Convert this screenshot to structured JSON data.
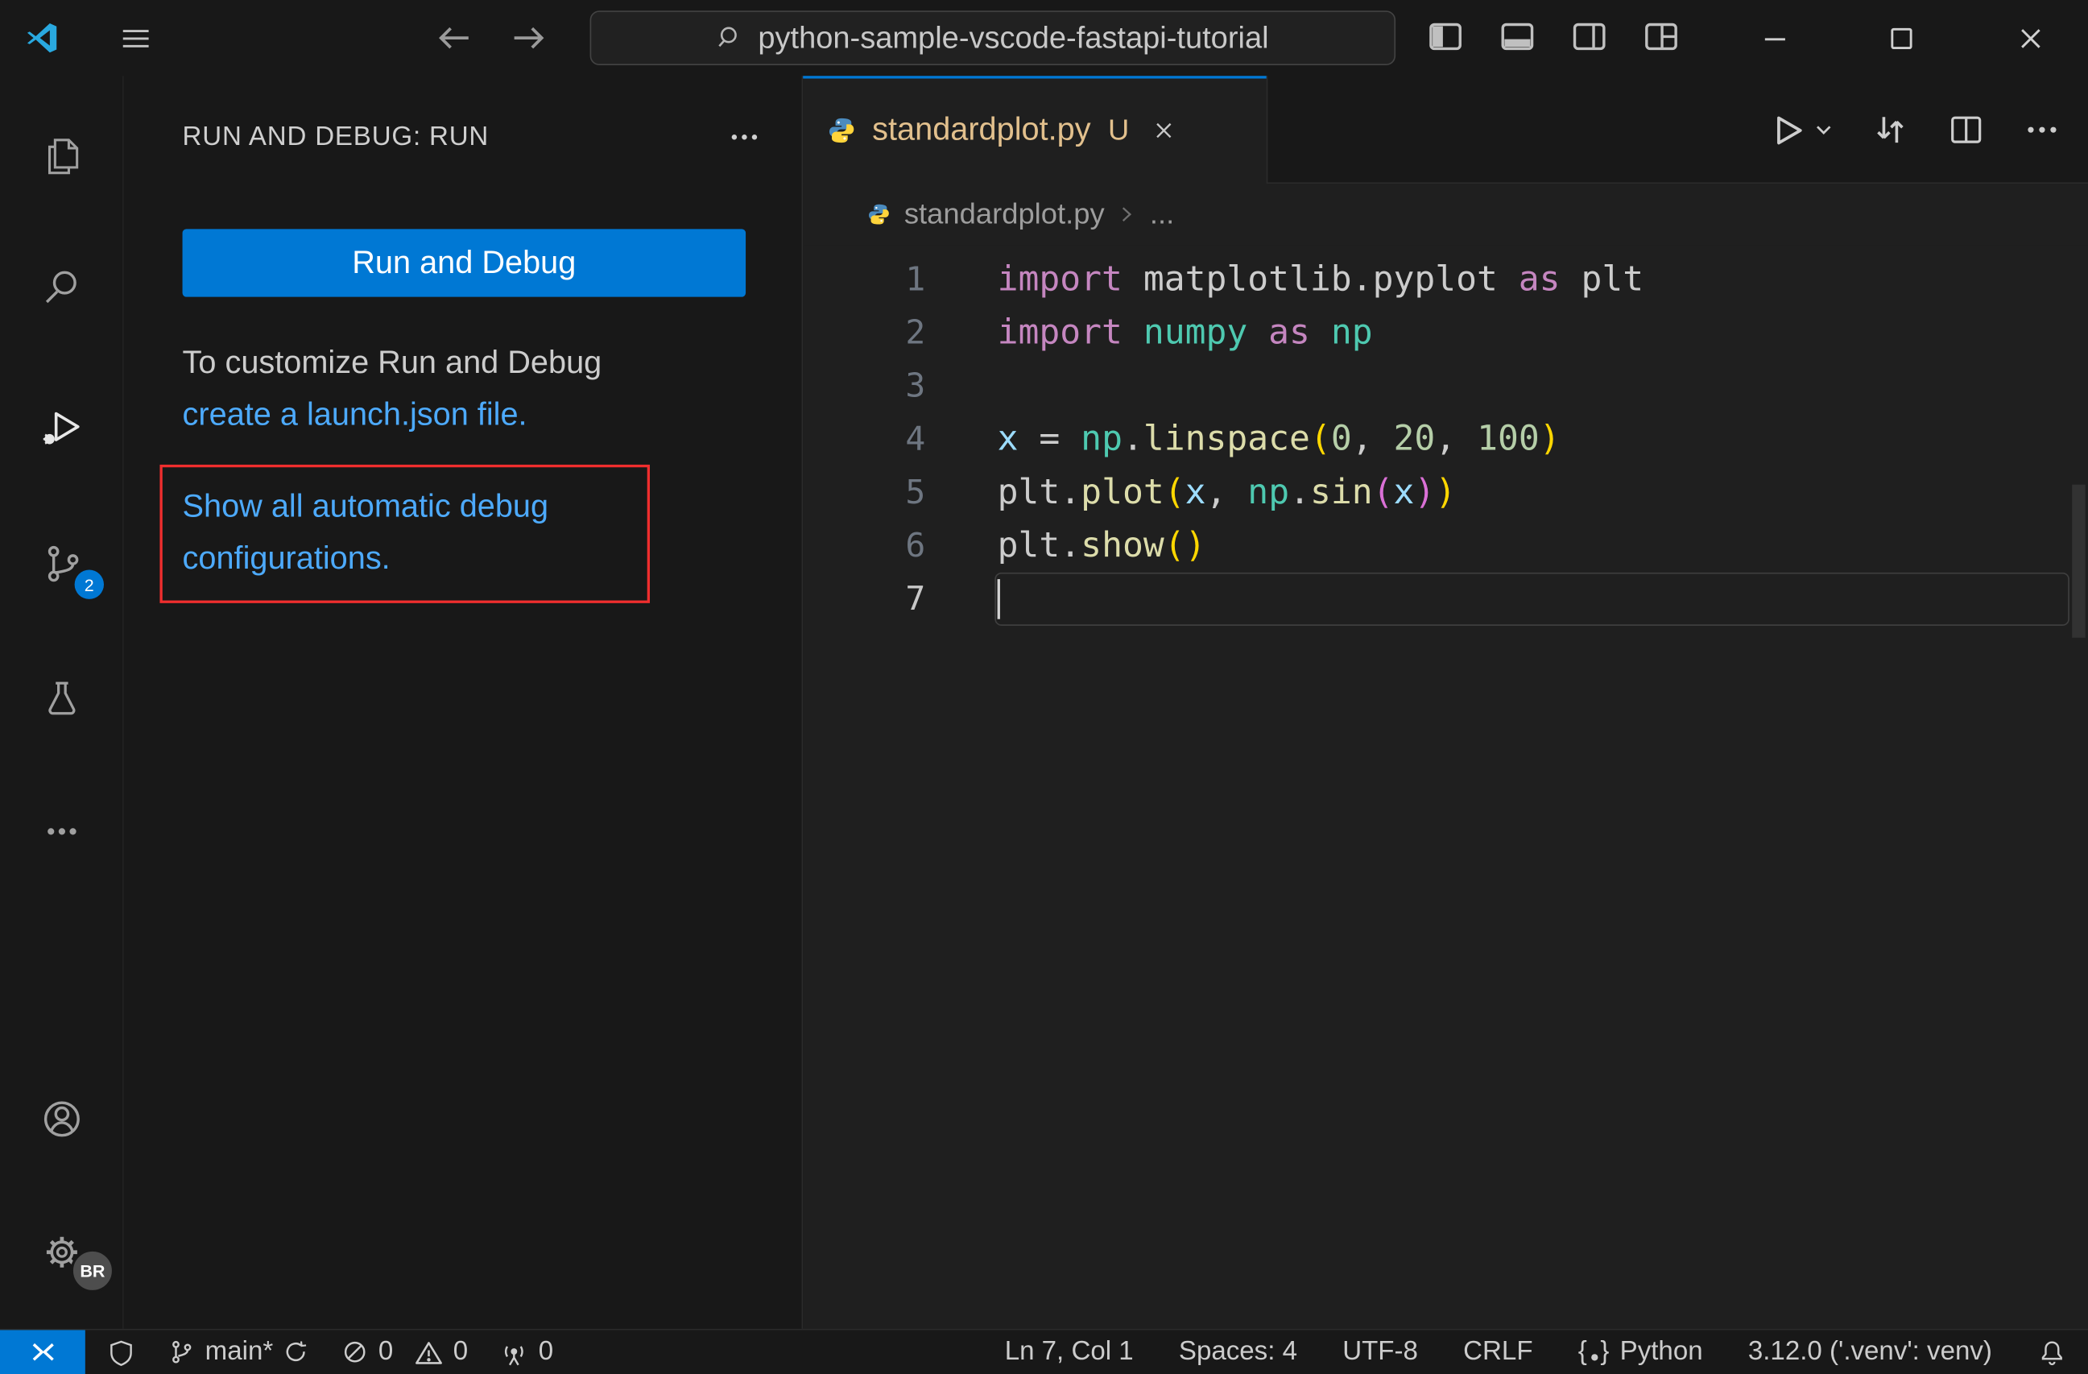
{
  "colors": {
    "accent": "#0078d4",
    "link": "#4daafc",
    "annotation_red": "#f02e2e",
    "tab_label": "#e2c08d",
    "syntax": {
      "kw": "#c586c0",
      "mod": "#4ec9b0",
      "fn": "#dcdcaa",
      "var": "#9cdcfe",
      "num": "#b5cea8",
      "plain": "#cccccc",
      "b1": "#ffd700",
      "b2": "#da70d6"
    }
  },
  "icons": {
    "title_bar": [
      "vscode-logo",
      "menu",
      "back-arrow",
      "forward-arrow",
      "search",
      "panel-left",
      "panel-bottom",
      "panel-right",
      "customize-layout",
      "minimize",
      "maximize",
      "close"
    ],
    "activity_bar": [
      "explorer-files",
      "search-magnifier",
      "run-and-debug-play-bug",
      "source-control-branch",
      "testing-beaker",
      "more-views-ellipsis",
      "account-person",
      "settings-gear"
    ],
    "editor": [
      "python-logo",
      "run-play",
      "chevron-down",
      "open-changes-arrows",
      "split-editor",
      "more-actions-ellipsis",
      "close-x"
    ],
    "status_bar": [
      "remote-brackets",
      "trust-shield",
      "git-branch",
      "sync",
      "errors-circle-slash",
      "warnings-triangle",
      "ports-broadcast",
      "braces",
      "bell"
    ]
  },
  "title_bar": {
    "search_text": "python-sample-vscode-fastapi-tutorial"
  },
  "activity_bar": {
    "scm_badge": "2",
    "profile_badge": "BR"
  },
  "sidebar": {
    "title": "RUN AND DEBUG: RUN",
    "run_button_label": "Run and Debug",
    "customize_text": "To customize Run and Debug",
    "launch_link": "create a launch.json file.",
    "auto_configs_link": "Show all automatic debug configurations."
  },
  "editor": {
    "tab_filename": "standardplot.py",
    "tab_git_status": "U",
    "breadcrumb_file": "standardplot.py",
    "breadcrumb_more": "...",
    "code_lines": [
      {
        "n": "1",
        "tokens": [
          [
            "kw",
            "import"
          ],
          [
            "plain",
            " matplotlib.pyplot "
          ],
          [
            "kw",
            "as"
          ],
          [
            "plain",
            " plt"
          ]
        ]
      },
      {
        "n": "2",
        "tokens": [
          [
            "kw",
            "import"
          ],
          [
            "plain",
            " "
          ],
          [
            "mod",
            "numpy"
          ],
          [
            "plain",
            " "
          ],
          [
            "kw",
            "as"
          ],
          [
            "plain",
            " "
          ],
          [
            "mod",
            "np"
          ]
        ]
      },
      {
        "n": "3",
        "tokens": []
      },
      {
        "n": "4",
        "tokens": [
          [
            "var",
            "x"
          ],
          [
            "plain",
            " = "
          ],
          [
            "mod",
            "np"
          ],
          [
            "plain",
            "."
          ],
          [
            "fn",
            "linspace"
          ],
          [
            "b1",
            "("
          ],
          [
            "num",
            "0"
          ],
          [
            "plain",
            ", "
          ],
          [
            "num",
            "20"
          ],
          [
            "plain",
            ", "
          ],
          [
            "num",
            "100"
          ],
          [
            "b1",
            ")"
          ]
        ]
      },
      {
        "n": "5",
        "tokens": [
          [
            "plain",
            "plt"
          ],
          [
            "plain",
            "."
          ],
          [
            "fn",
            "plot"
          ],
          [
            "b1",
            "("
          ],
          [
            "var",
            "x"
          ],
          [
            "plain",
            ", "
          ],
          [
            "mod",
            "np"
          ],
          [
            "plain",
            "."
          ],
          [
            "fn",
            "sin"
          ],
          [
            "b2",
            "("
          ],
          [
            "var",
            "x"
          ],
          [
            "b2",
            ")"
          ],
          [
            "b1",
            ")"
          ]
        ]
      },
      {
        "n": "6",
        "tokens": [
          [
            "plain",
            "plt."
          ],
          [
            "fn",
            "show"
          ],
          [
            "b1",
            "()"
          ]
        ]
      },
      {
        "n": "7",
        "tokens": [],
        "cursor": true,
        "current": true
      }
    ]
  },
  "status_bar": {
    "branch": "main*",
    "errors": "0",
    "warnings": "0",
    "ports": "0",
    "line_col": "Ln 7, Col 1",
    "indent": "Spaces: 4",
    "encoding": "UTF-8",
    "eol": "CRLF",
    "language": "Python",
    "interpreter": "3.12.0 ('.venv': venv)"
  }
}
